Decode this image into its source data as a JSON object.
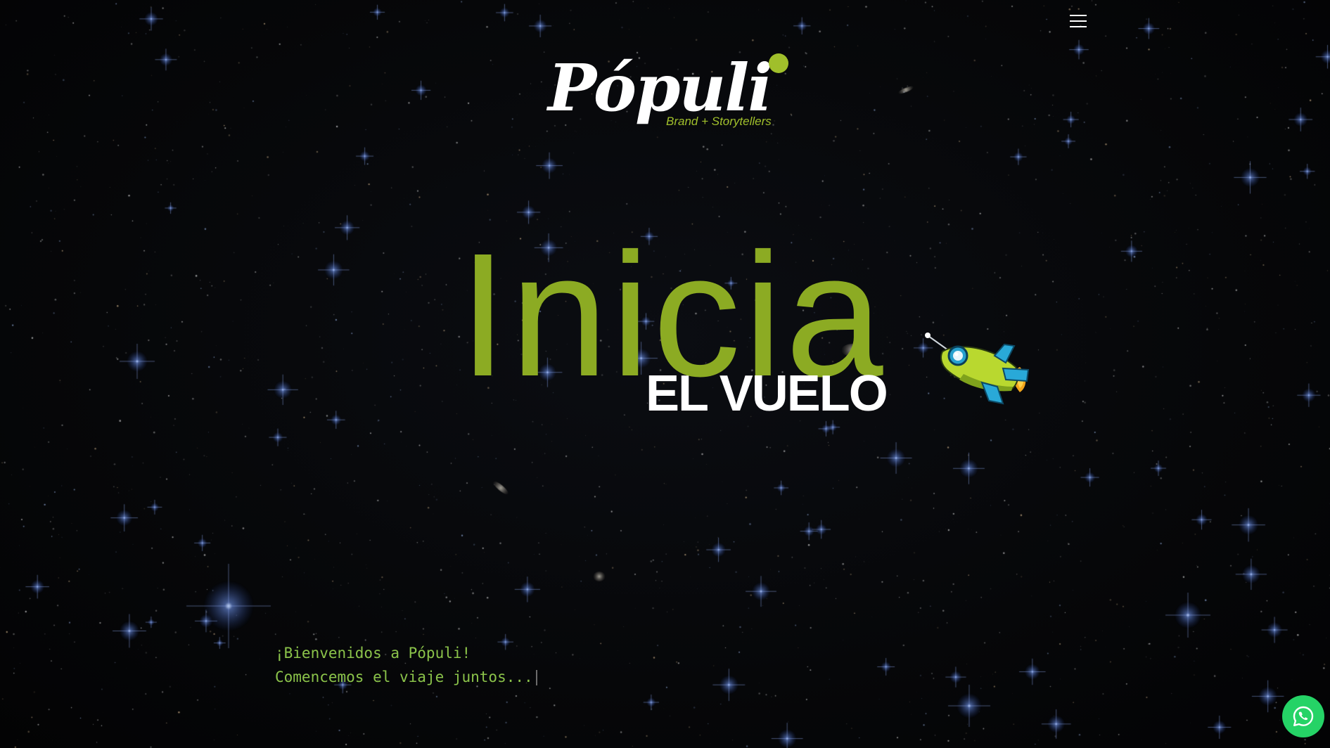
{
  "header": {
    "menu_icon": "hamburger-icon"
  },
  "logo": {
    "name": "Pópuli",
    "tagline": "Brand + Storytellers",
    "accent_color": "#a0bf2b"
  },
  "hero": {
    "headline": "Inicia",
    "subheadline": "EL VUELO",
    "headline_color": "#8cab23",
    "illustration": "rocket-icon"
  },
  "intro": {
    "line1": "¡Bienvenidos a Pópuli!",
    "line2": "Comencemos el viaje juntos...",
    "text_color": "#8bc34a"
  },
  "whatsapp": {
    "icon": "whatsapp-icon",
    "color": "#25d366"
  }
}
